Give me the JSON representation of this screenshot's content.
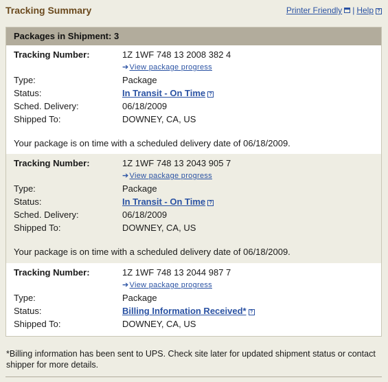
{
  "page": {
    "title": "Tracking Summary",
    "printer_friendly": "Printer Friendly",
    "separator": "|",
    "help": "Help"
  },
  "summary": {
    "packages_label": "Packages in Shipment:",
    "packages_count": "3"
  },
  "labels": {
    "tracking_number": "Tracking Number:",
    "view_progress": "View package progress",
    "type": "Type:",
    "status": "Status:",
    "sched_delivery": "Sched. Delivery:",
    "shipped_to": "Shipped To:"
  },
  "packages": [
    {
      "tracking_number": "1Z 1WF 748 13 2008 382 4",
      "type": "Package",
      "status": "In Transit - On Time",
      "sched_delivery": "06/18/2009",
      "shipped_to": "DOWNEY,  CA,  US",
      "message": "Your package is on time with a scheduled delivery date of 06/18/2009."
    },
    {
      "tracking_number": "1Z 1WF 748 13 2043 905 7",
      "type": "Package",
      "status": "In Transit - On Time",
      "sched_delivery": "06/18/2009",
      "shipped_to": "DOWNEY,  CA,  US",
      "message": "Your package is on time with a scheduled delivery date of 06/18/2009."
    },
    {
      "tracking_number": "1Z 1WF 748 13 2044 987 7",
      "type": "Package",
      "status": "Billing Information Received*",
      "shipped_to": "DOWNEY,  CA,  US"
    }
  ],
  "footnote": "*Billing information has been sent to UPS. Check site later for updated shipment status or contact shipper for more details.",
  "icons": {
    "help": "help-icon",
    "printer": "printer-icon",
    "arrow": "arrow-right-icon"
  },
  "colors": {
    "title": "#6b4a1e",
    "link": "#2a52a3",
    "header_bg": "#b2ac9c",
    "shaded_bg": "#eeede3"
  }
}
